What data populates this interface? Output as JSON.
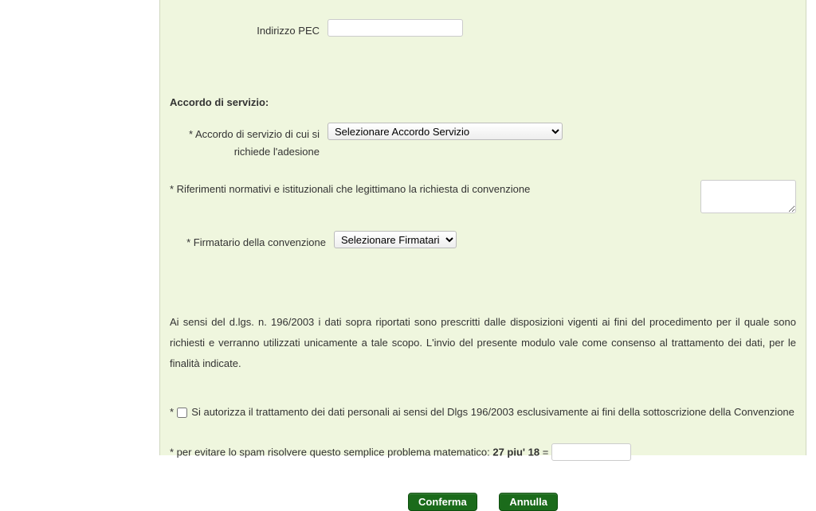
{
  "fields": {
    "pec": {
      "label": "Indirizzo PEC",
      "value": ""
    },
    "accordo": {
      "section_title": "Accordo di servizio:",
      "label": "* Accordo di servizio di cui si richiede l'adesione",
      "selected": "Selezionare Accordo Servizio"
    },
    "riferimenti": {
      "label": "* Riferimenti normativi e istituzionali che legittimano la richiesta di convenzione",
      "value": ""
    },
    "firmatario": {
      "label": "* Firmatario della convenzione",
      "selected": "Selezionare Firmatario"
    }
  },
  "privacy": {
    "text": "Ai sensi del d.lgs. n. 196/2003 i dati sopra riportati sono prescritti dalle disposizioni vigenti ai fini del procedimento per il quale sono richiesti e verranno utilizzati unicamente a tale scopo. L'invio del presente modulo vale come consenso al trattamento dei dati, per le finalità indicate.",
    "checkbox_prefix": "* ",
    "checkbox_label": "Si autorizza il trattamento dei dati personali ai sensi del Dlgs 196/2003 esclusivamente ai fini della sottoscrizione della Convenzione"
  },
  "captcha": {
    "prefix": "* per evitare lo spam risolvere questo semplice problema matematico: ",
    "question": "27 piu' 18",
    "equals": " = ",
    "value": ""
  },
  "buttons": {
    "confirm": "Conferma",
    "cancel": "Annulla"
  }
}
